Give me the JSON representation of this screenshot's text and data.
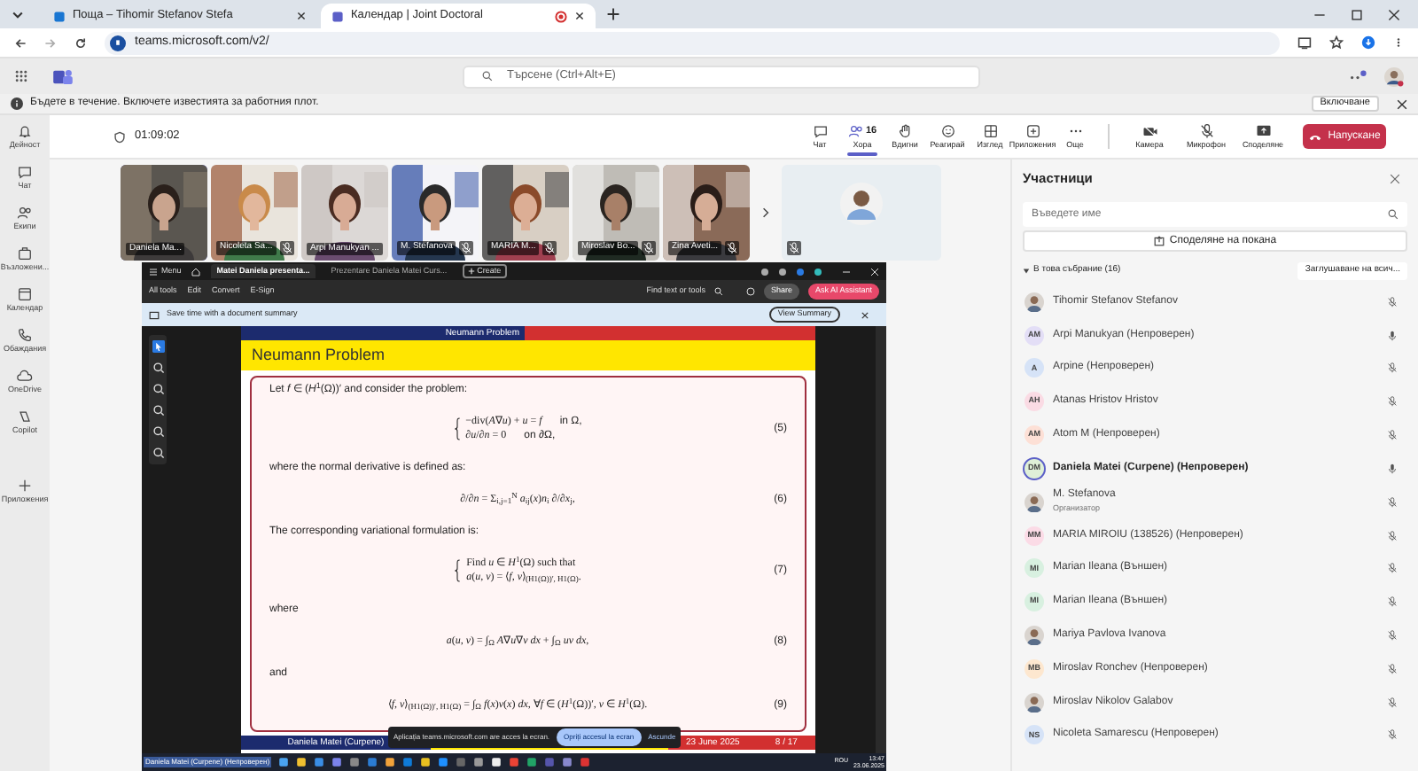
{
  "browser": {
    "tabs": [
      {
        "label": "Поща – Tihomir Stefanov Stefa",
        "selected": false
      },
      {
        "label": "Календар | Joint Doctoral",
        "selected": true
      }
    ],
    "address": "teams.microsoft.com/v2/"
  },
  "teams_header": {
    "search_placeholder": "Търсене (Ctrl+Alt+E)"
  },
  "notification": {
    "text": "Бъдете в течение. Включете известията за работния плот.",
    "button": "Включване"
  },
  "rail": [
    {
      "label": "Дейност"
    },
    {
      "label": "Чат"
    },
    {
      "label": "Екипи"
    },
    {
      "label": "Възложени..."
    },
    {
      "label": "Календар"
    },
    {
      "label": "Обаждания"
    },
    {
      "label": "OneDrive"
    },
    {
      "label": "Copilot"
    },
    {
      "label": "Приложения"
    }
  ],
  "meeting_toolbar": {
    "timer": "01:09:02",
    "buttons": [
      {
        "label": "Чат",
        "selected": false
      },
      {
        "label": "Хора",
        "count": "16",
        "selected": true
      },
      {
        "label": "Вдигни",
        "selected": false
      },
      {
        "label": "Реагирай",
        "selected": false
      },
      {
        "label": "Изглед",
        "selected": false
      },
      {
        "label": "Приложения",
        "selected": false
      },
      {
        "label": "Още",
        "selected": false
      },
      {
        "label": "Камера",
        "selected": false
      },
      {
        "label": "Микрофон",
        "selected": false
      },
      {
        "label": "Споделяне",
        "selected": false
      }
    ],
    "leave": "Напускане"
  },
  "video_tiles": [
    {
      "kind": "video",
      "name": "Daniela Ma...",
      "speaking": true,
      "muted": false
    },
    {
      "kind": "video",
      "name": "Nicoleta Sa...",
      "speaking": false,
      "muted": true
    },
    {
      "kind": "video",
      "name": "Arpi Manukyan ...",
      "speaking": false,
      "muted": false
    },
    {
      "kind": "video",
      "name": "M. Stefanova",
      "speaking": false,
      "muted": true
    },
    {
      "kind": "video",
      "name": "MARIA M...",
      "speaking": false,
      "muted": true
    },
    {
      "kind": "video",
      "name": "Miroslav Bo...",
      "speaking": false,
      "muted": true
    },
    {
      "kind": "video",
      "name": "Zina Aveti...",
      "speaking": false,
      "muted": true
    },
    {
      "kind": "avatar",
      "speaking": false,
      "muted": true
    }
  ],
  "shared_screen": {
    "menu": "Menu",
    "tabs": [
      {
        "label": "Matei Daniela presenta...",
        "selected": true
      },
      {
        "label": "Prezentare Daniela Matei Curs...",
        "selected": false
      }
    ],
    "create": "Create",
    "menu_items": [
      "All tools",
      "Edit",
      "Convert",
      "E-Sign"
    ],
    "find": "Find text or tools",
    "share": "Share",
    "ai": "Ask AI Assistant",
    "banner": "Save time with a document summary",
    "banner_button": "View Summary",
    "slide": {
      "header": "Neumann Problem",
      "title": "Neumann Problem",
      "blocks": [
        {
          "kind": "text",
          "text": "Let *f* ∈ (*H*$^{1}$(Ω))′ and consider the problem:"
        },
        {
          "kind": "equation",
          "brace": true,
          "number": "(5)",
          "lines": [
            {
              "expr": "−div(*A*∇*u*) + *u* = *f*",
              "cond": "in Ω,"
            },
            {
              "expr": "∂*u*/∂*n* = 0",
              "cond": "on ∂Ω,"
            }
          ]
        },
        {
          "kind": "text",
          "text": "where the normal derivative is defined as:"
        },
        {
          "kind": "equation",
          "brace": false,
          "number": "(6)",
          "lines": [
            {
              "expr": "∂/∂*n* = Σ$_{i,j=1}$$^{N}$ *a*$_{ij}$(*x*)*n*$_{i}$ ∂/∂*x*$_{j}$,"
            }
          ]
        },
        {
          "kind": "text",
          "text": "The corresponding variational formulation is:"
        },
        {
          "kind": "equation",
          "brace": true,
          "number": "(7)",
          "lines": [
            {
              "expr": "Find *u* ∈ *H*$^{1}$(Ω) such that"
            },
            {
              "expr": "*a*(*u*, *v*) = ⟨*f*, *v*⟩$_{(H1(Ω))′, H1(Ω)}$."
            }
          ]
        },
        {
          "kind": "text",
          "text": "where"
        },
        {
          "kind": "equation",
          "brace": false,
          "number": "(8)",
          "lines": [
            {
              "expr": "*a*(*u*, *v*) = ∫$_{Ω}$ *A*∇*u*∇*v dx* + ∫$_{Ω}$ *uv dx*,"
            }
          ]
        },
        {
          "kind": "text",
          "text": "and"
        },
        {
          "kind": "equation",
          "brace": false,
          "number": "(9)",
          "lines": [
            {
              "expr": "⟨*f*, *v*⟩$_{(H1(Ω))′, H1(Ω)}$ = ∫$_{Ω}$ *f*(*x*)*v*(*x*) *dx*,   ∀*f* ∈ (*H*$^{1}$(Ω))′, *v* ∈ *H*$^{1}$(Ω)."
            }
          ]
        }
      ],
      "footer": [
        "Daniela Matei (Curpene)",
        "23 June 2025",
        "8 / 17"
      ]
    },
    "share_prompt": {
      "text": "Aplicația teams.microsoft.com are acces la ecran.",
      "stop": "Opriți accesul la ecran",
      "hide": "Ascunde"
    },
    "taskbar": {
      "presenter": "Daniela Matei (Curpene) (Непроверен)",
      "lang": "ROU",
      "time": "13:47",
      "date": "23.06.2025"
    }
  },
  "participants": {
    "title": "Участници",
    "search_placeholder": "Въведете име",
    "invite": "Споделяне на покана",
    "section": "В това събрание (16)",
    "mute_all": "Заглушаване на всич...",
    "people": [
      {
        "name": "Tihomir Stefanov Stefanov",
        "muted": true,
        "speaking": false
      },
      {
        "name": "Arpi Manukyan (Непроверен)",
        "kind": "initials",
        "initials": "AM",
        "color": "#e3def6",
        "muted": false,
        "speaking": false
      },
      {
        "name": "Arpine (Непроверен)",
        "kind": "initials",
        "initials": "A",
        "color": "#d6e3f7",
        "muted": true,
        "speaking": false
      },
      {
        "name": "Atanas Hristov Hristov",
        "kind": "initials",
        "initials": "AH",
        "color": "#fadbe4",
        "muted": true,
        "speaking": false
      },
      {
        "name": "Atom M (Непроверен)",
        "kind": "initials",
        "initials": "AM",
        "color": "#fde0d6",
        "muted": true,
        "speaking": false
      },
      {
        "name": "Daniela Matei (Curpene) (Непроверен)",
        "kind": "initials",
        "initials": "DM",
        "color": "#dff0d8",
        "muted": false,
        "speaking": true
      },
      {
        "name": "M. Stefanova",
        "role": "Организатор",
        "muted": true,
        "speaking": false
      },
      {
        "name": "MARIA MIROIU (138526) (Непроверен)",
        "kind": "initials",
        "initials": "MM",
        "color": "#fbdbe6",
        "muted": true,
        "speaking": false
      },
      {
        "name": "Marian Ileana (Външен)",
        "kind": "initials",
        "initials": "MI",
        "color": "#d8f0e0",
        "muted": true,
        "speaking": false
      },
      {
        "name": "Marian Ileana (Външен)",
        "kind": "initials",
        "initials": "MI",
        "color": "#d8f0e0",
        "muted": true,
        "speaking": false
      },
      {
        "name": "Mariya Pavlova Ivanova",
        "muted": true,
        "speaking": false
      },
      {
        "name": "Miroslav Ronchev (Непроверен)",
        "kind": "initials",
        "initials": "MB",
        "color": "#fde7cf",
        "muted": true,
        "speaking": false
      },
      {
        "name": "Miroslav Nikolov Galabov",
        "muted": true,
        "speaking": false
      },
      {
        "name": "Nicoleta Samarescu (Непроверен)",
        "kind": "initials",
        "initials": "NS",
        "color": "#d6e3f7",
        "muted": true,
        "speaking": false
      }
    ]
  }
}
